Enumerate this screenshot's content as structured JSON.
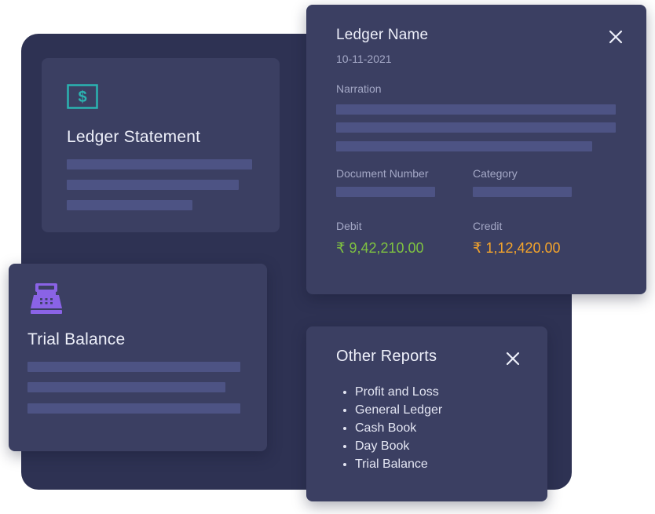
{
  "ledger_statement": {
    "title": "Ledger Statement",
    "icon": "dollar-box-icon",
    "icon_color": "#2bb3b1"
  },
  "trial_balance": {
    "title": "Trial Balance",
    "icon": "cash-register-icon",
    "icon_color": "#8a63e6"
  },
  "ledger_detail": {
    "title": "Ledger Name",
    "date": "10-11-2021",
    "narration_label": "Narration",
    "document_number_label": "Document Number",
    "category_label": "Category",
    "debit_label": "Debit",
    "debit_value": "₹ 9,42,210.00",
    "debit_color": "#7fc241",
    "credit_label": "Credit",
    "credit_value": "₹ 1,12,420.00",
    "credit_color": "#f4a42b"
  },
  "other_reports": {
    "title": "Other Reports",
    "items": [
      "Profit and Loss",
      "General Ledger",
      "Cash Book",
      "Day Book",
      "Trial Balance"
    ]
  },
  "colors": {
    "background_panel": "#2e3253",
    "card": "#3b3f62",
    "placeholder_bar": "#4d5384"
  }
}
